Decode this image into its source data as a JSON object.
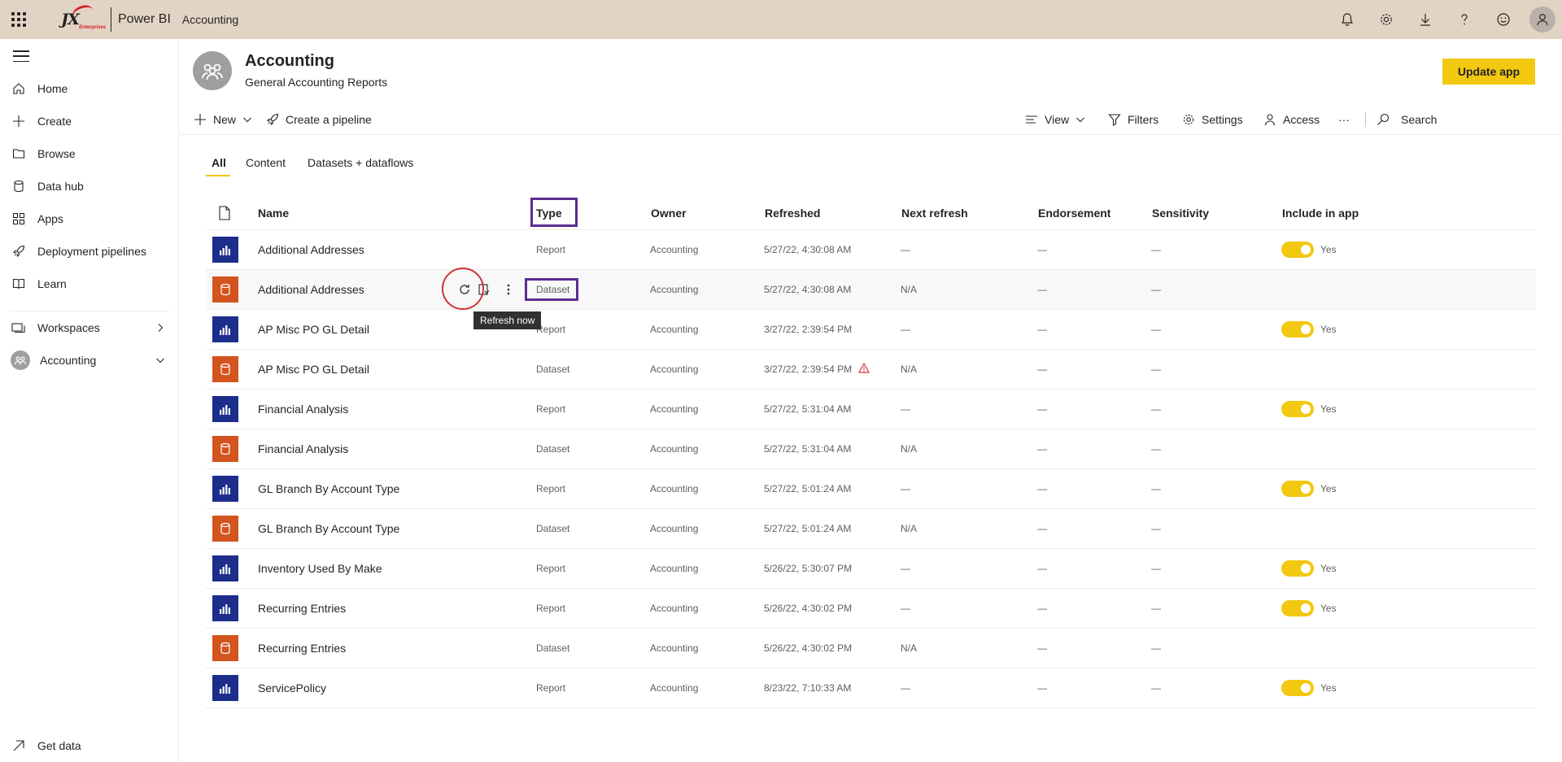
{
  "topbar": {
    "logo_text": "JX",
    "logo_sub": "Enterprises",
    "product": "Power BI",
    "breadcrumb": "Accounting"
  },
  "sidebar": {
    "items": [
      {
        "label": "Home",
        "icon": "home-icon"
      },
      {
        "label": "Create",
        "icon": "plus-icon"
      },
      {
        "label": "Browse",
        "icon": "folder-icon"
      },
      {
        "label": "Data hub",
        "icon": "database-icon"
      },
      {
        "label": "Apps",
        "icon": "apps-icon"
      },
      {
        "label": "Deployment pipelines",
        "icon": "rocket-icon"
      },
      {
        "label": "Learn",
        "icon": "book-icon"
      }
    ],
    "workspaces_label": "Workspaces",
    "current_workspace": "Accounting",
    "get_data_label": "Get data"
  },
  "header": {
    "title": "Accounting",
    "subtitle": "General Accounting Reports",
    "update_button": "Update app"
  },
  "toolbar": {
    "new_label": "New",
    "pipeline_label": "Create a pipeline",
    "view_label": "View",
    "filters_label": "Filters",
    "settings_label": "Settings",
    "access_label": "Access",
    "more_label": "···",
    "search_label": "Search"
  },
  "tabs": [
    {
      "label": "All",
      "active": true
    },
    {
      "label": "Content",
      "active": false
    },
    {
      "label": "Datasets + dataflows",
      "active": false
    }
  ],
  "table": {
    "columns": [
      "Name",
      "Type",
      "Owner",
      "Refreshed",
      "Next refresh",
      "Endorsement",
      "Sensitivity",
      "Include in app"
    ],
    "rows": [
      {
        "name": "Additional Addresses",
        "type": "Report",
        "owner": "Accounting",
        "refreshed": "5/27/22, 4:30:08 AM",
        "next": "—",
        "endorsement": "—",
        "sensitivity": "—",
        "include": "Yes"
      },
      {
        "name": "Additional Addresses",
        "type": "Dataset",
        "owner": "Accounting",
        "refreshed": "5/27/22, 4:30:08 AM",
        "next": "N/A",
        "endorsement": "—",
        "sensitivity": "—",
        "include": ""
      },
      {
        "name": "AP Misc PO GL Detail",
        "type": "Report",
        "owner": "Accounting",
        "refreshed": "3/27/22, 2:39:54 PM",
        "next": "—",
        "endorsement": "—",
        "sensitivity": "—",
        "include": "Yes"
      },
      {
        "name": "AP Misc PO GL Detail",
        "type": "Dataset",
        "owner": "Accounting",
        "refreshed": "3/27/22, 2:39:54 PM",
        "next": "N/A",
        "endorsement": "—",
        "sensitivity": "—",
        "include": "",
        "warning": true
      },
      {
        "name": "Financial Analysis",
        "type": "Report",
        "owner": "Accounting",
        "refreshed": "5/27/22, 5:31:04 AM",
        "next": "—",
        "endorsement": "—",
        "sensitivity": "—",
        "include": "Yes"
      },
      {
        "name": "Financial Analysis",
        "type": "Dataset",
        "owner": "Accounting",
        "refreshed": "5/27/22, 5:31:04 AM",
        "next": "N/A",
        "endorsement": "—",
        "sensitivity": "—",
        "include": ""
      },
      {
        "name": "GL Branch By Account Type",
        "type": "Report",
        "owner": "Accounting",
        "refreshed": "5/27/22, 5:01:24 AM",
        "next": "—",
        "endorsement": "—",
        "sensitivity": "—",
        "include": "Yes"
      },
      {
        "name": "GL Branch By Account Type",
        "type": "Dataset",
        "owner": "Accounting",
        "refreshed": "5/27/22, 5:01:24 AM",
        "next": "N/A",
        "endorsement": "—",
        "sensitivity": "—",
        "include": ""
      },
      {
        "name": "Inventory Used By Make",
        "type": "Report",
        "owner": "Accounting",
        "refreshed": "5/26/22, 5:30:07 PM",
        "next": "—",
        "endorsement": "—",
        "sensitivity": "—",
        "include": "Yes"
      },
      {
        "name": "Recurring Entries",
        "type": "Report",
        "owner": "Accounting",
        "refreshed": "5/26/22, 4:30:02 PM",
        "next": "—",
        "endorsement": "—",
        "sensitivity": "—",
        "include": "Yes"
      },
      {
        "name": "Recurring Entries",
        "type": "Dataset",
        "owner": "Accounting",
        "refreshed": "5/26/22, 4:30:02 PM",
        "next": "N/A",
        "endorsement": "—",
        "sensitivity": "—",
        "include": ""
      },
      {
        "name": "ServicePolicy",
        "type": "Report",
        "owner": "Accounting",
        "refreshed": "8/23/22, 7:10:33 AM",
        "next": "—",
        "endorsement": "—",
        "sensitivity": "—",
        "include": "Yes"
      }
    ]
  },
  "tooltip": "Refresh now",
  "colors": {
    "topbar": "#e2d4c4",
    "accent": "#f2c811",
    "report": "#1c2d8c",
    "dataset": "#d3541e",
    "annotation_box": "#5c2d91",
    "annotation_circle": "#d13438"
  }
}
